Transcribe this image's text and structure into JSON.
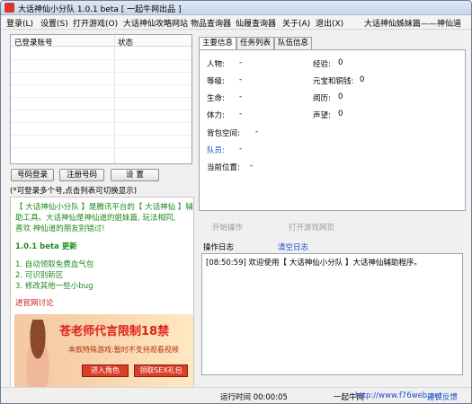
{
  "window": {
    "title": "大话神仙小分队 1.0.1 beta [ 一起牛网出品 ]"
  },
  "menu": {
    "items": [
      "登录(L)",
      "设置(S)",
      "打开游戏(O)",
      "大话神仙攻略网站",
      "物品查询器",
      "仙履查询器",
      "关于(A)",
      "退出(X)"
    ],
    "right_text": "大话神仙姊妹篇——神仙道"
  },
  "accounts": {
    "columns": [
      "已登录账号",
      "状态"
    ],
    "rows": []
  },
  "buttons": {
    "number_login": "号码登录",
    "register": "注册号码",
    "settings": "设 置"
  },
  "hint": "(*可登录多个号,点击列表可切换显示)",
  "info": {
    "intro_a": "【 大话神仙小分队 】是腾讯平台的【 大话神仙 】辅",
    "intro_b": "助工具。大话神仙是神仙道的姐妹篇, 玩法相同,",
    "intro_c": "喜欢  神仙道的朋友别错过!",
    "update_title": "1.0.1 beta 更新",
    "updates": [
      "1. 自动领取免费血气包",
      "2. 可识别新区",
      "3. 修改其他一些小bug"
    ],
    "forum_link": "进官网讨论",
    "banner_text": "苍老师代言限制18禁",
    "banner_sub": "本款特殊游戏:暂时不支持观看视频",
    "banner_btn1": "进入角色",
    "banner_btn2": "领取SEX礼包"
  },
  "tabs": [
    "主要信息",
    "任务列表",
    "队伍信息"
  ],
  "stats": {
    "character": {
      "label": "人物:",
      "value": "-"
    },
    "experience": {
      "label": "经验:",
      "value": "0"
    },
    "level": {
      "label": "等级:",
      "value": "-"
    },
    "currency": {
      "label": "元宝和铜钱:",
      "value": "0"
    },
    "life": {
      "label": "生命:",
      "value": "-"
    },
    "experience2": {
      "label": "阅历:",
      "value": "0"
    },
    "stamina": {
      "label": "体力:",
      "value": "-"
    },
    "fame": {
      "label": "声望:",
      "value": "0"
    },
    "bag_space": {
      "label": "背包空间:",
      "value": "-"
    },
    "team_members": {
      "label": "队员:",
      "value": "-"
    },
    "position": {
      "label": "当前位置:",
      "value": "-"
    }
  },
  "actions": {
    "start": "开始操作",
    "open_page": "打开游戏网页"
  },
  "log": {
    "label": "操作日志",
    "clear": "清空日志",
    "entries": [
      "[08:50:59] 欢迎使用【 大话神仙小分队 】大话神仙辅助程序。"
    ]
  },
  "status": {
    "runtime": "运行时间 00:00:05",
    "brand": "一起牛网",
    "site": "http://www.f76web.net",
    "feedback": "建议反馈"
  }
}
